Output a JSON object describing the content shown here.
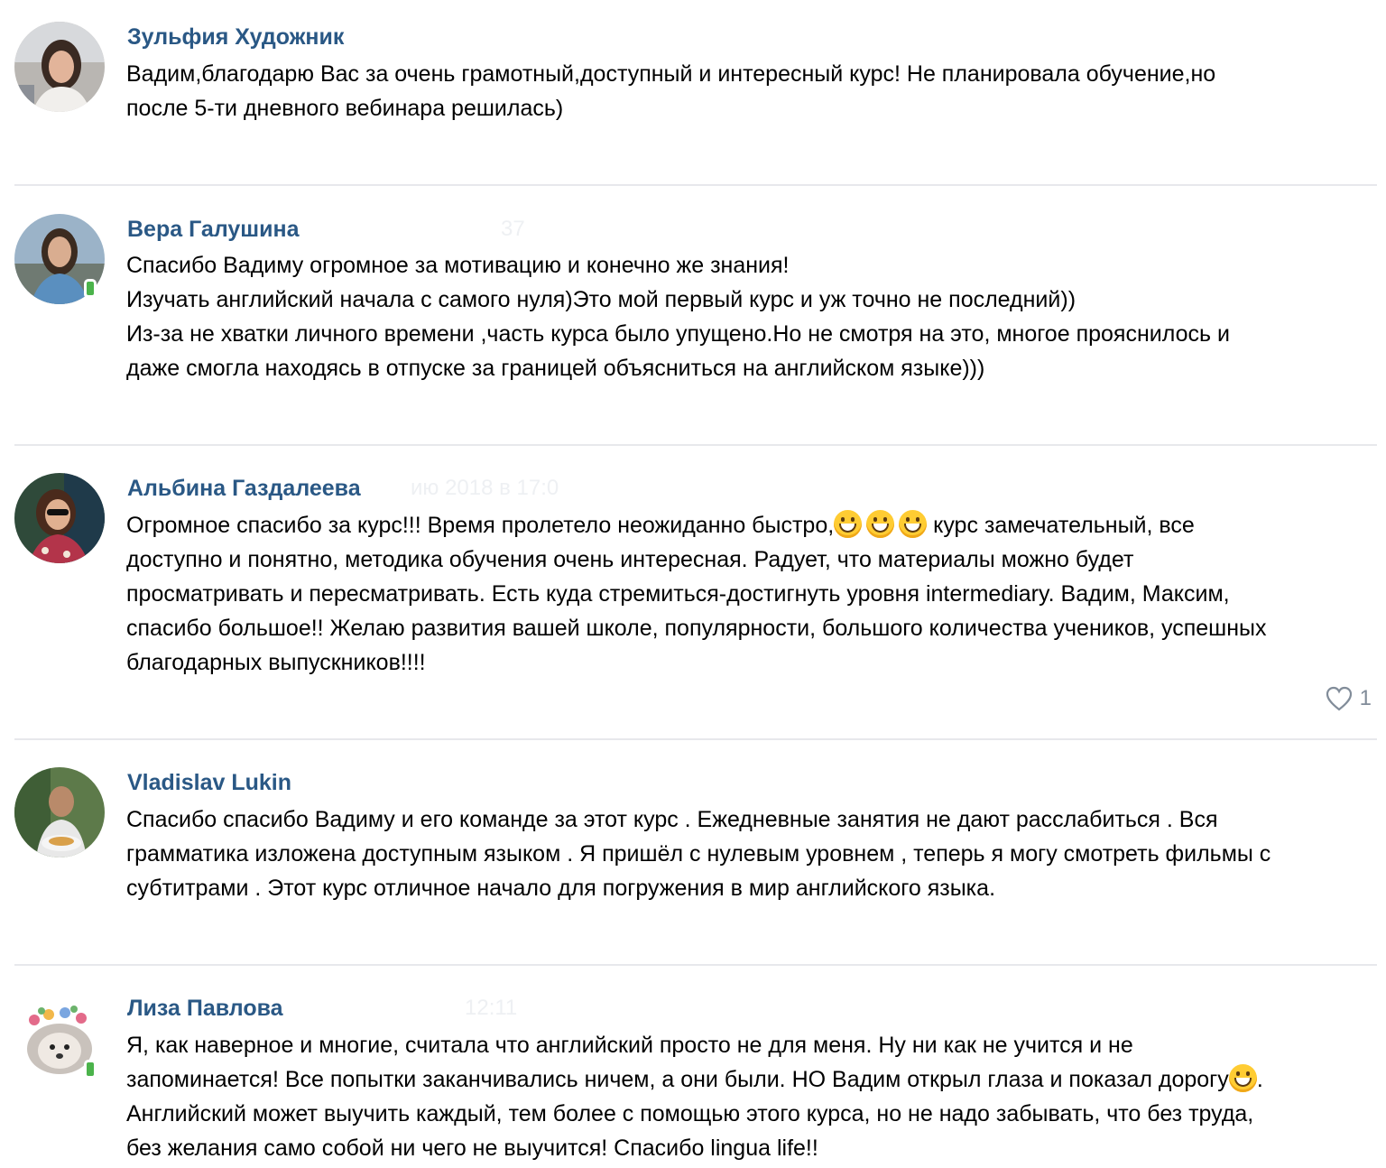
{
  "comments": [
    {
      "author": "Зульфия Художник",
      "meta": "",
      "text_lines": [
        "Вадим,благодарю Вас за очень грамотный,доступный и интересный курс! Не планировала обучение,но",
        "после 5-ти дневного вебинара решилась)"
      ]
    },
    {
      "author": "Вера Галушина",
      "meta": "37",
      "text_lines": [
        "Спасибо Вадиму огромное за мотивацию и конечно же знания!",
        "Изучать английский начала с самого нуля)Это мой первый курс и уж точно не последний))",
        "Из-за не хватки личного времени ,часть курса было упущено.Но не смотря на это, многое прояснилось и",
        "даже смогла находясь в отпуске за границей объясниться на английском языке)))"
      ]
    },
    {
      "author": "Альбина Газдалеева",
      "meta": "ию 2018 в 17:0",
      "text_lines": [
        "Огромное спасибо за курс!!! Время пролетело неожиданно быстро,",
        "доступно и понятно, методика обучения очень интересная. Радует, что материалы можно будет",
        "просматривать и пересматривать. Есть куда стремиться-достигнуть уровня intermediary. Вадим, Максим,",
        "спасибо большое!! Желаю развития вашей школе, популярности, большого количества учеников, успешных",
        "благодарных выпускников!!!!"
      ],
      "line1_after_emoji": " курс замечательный, все",
      "emoji": "grinning-face-emoji",
      "likes": "1"
    },
    {
      "author": "Vladislav Lukin",
      "meta": "",
      "text_lines": [
        "Спасибо спасибо Вадиму и его команде за этот курс . Ежедневные занятия не дают расслабиться . Вся",
        "грамматика изложена доступным языком . Я пришёл с нулевым уровнем , теперь я могу смотреть фильмы с",
        "субтитрами . Этот курс отличное начало для погружения в мир английского языка."
      ]
    },
    {
      "author": "Лиза Павлова",
      "meta": "12:11",
      "text_lines": [
        "Я, как наверное и многие, считала что английский просто не для меня. Ну ни как не учится и не",
        "запоминается! Все попытки заканчивались ничем, а они были. НО Вадим открыл глаза и показал дорогу",
        "Английский может выучить каждый, тем более с помощью этого курса, но не надо забывать, что без труда,",
        "без желания само собой ни чего не выучится! Спасибо lingua life!!"
      ],
      "line2_after_emoji": ".",
      "emoji": "laughing-face-emoji"
    }
  ],
  "icons": {
    "mobile": "mobile-phone-icon",
    "like": "heart-icon"
  },
  "colors": {
    "author": "#2a5885",
    "divider": "#e7e8ec",
    "online_mobile": "#4bb34b",
    "like": "#818c99"
  }
}
